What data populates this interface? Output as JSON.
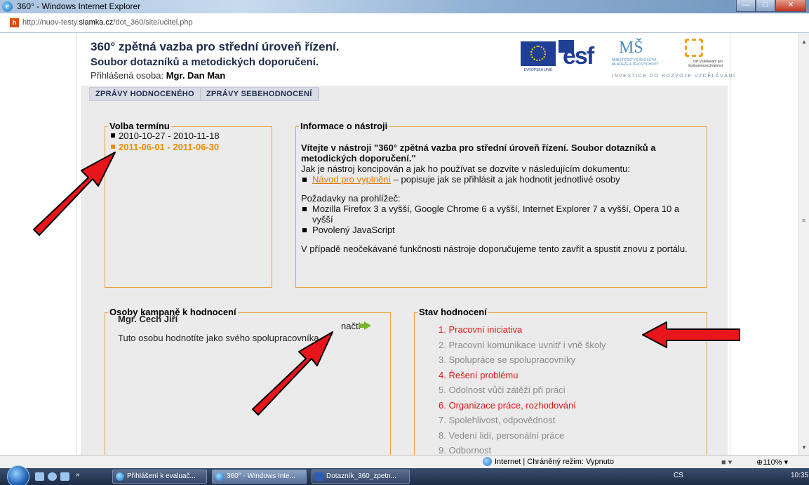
{
  "window": {
    "title": "360° - Windows Internet Explorer",
    "url_prefix": "http://nuov-testy.",
    "url_domain": "slamka.cz",
    "url_suffix": "/dot_360/site/ucitel.php"
  },
  "header": {
    "title": "360° zpětná vazba pro střední úroveň řízení.",
    "subtitle": "Soubor dotazníků a metodických doporučení.",
    "user_label": "Přihlášená osoba:",
    "user_name": "Mgr. Dan Man",
    "logo_tagline": "INVESTICE DO ROZVOJE VZDĚLÁVÁNÍ",
    "logo_eu_caption": "EVROPSKÁ UNIE",
    "logo_esf_text": "esf",
    "logo_msmt_caption": "MINISTERSTVO ŠKOLSTVÍ, MLÁDEŽE A TĚLOVÝCHOVY",
    "logo_op_caption": "OP Vzdělávání pro konkurenceschopnost"
  },
  "menu": [
    {
      "label": "ZPRÁVY HODNOCENÉHO"
    },
    {
      "label": "ZPRÁVY SEBEHODNOCENÍ"
    }
  ],
  "volba": {
    "legend": "Volba termínu",
    "terms": [
      {
        "label": "2010-10-27 - 2010-11-18"
      },
      {
        "label": "2011-06-01 - 2011-06-30"
      }
    ]
  },
  "info": {
    "legend": "Informace o nástroji",
    "welcome": "Vítejte v nástroji \"360° zpětná vazba pro střední úroveň řízení. Soubor dotazníků a metodických doporučení.\"",
    "intro": "Jak je nástroj koncipován a jak ho používat se dozvíte v následujícím dokumentu:",
    "doc_link": "Návod pro vyplnění",
    "doc_desc": " – popisuje jak se přihlásit a jak hodnotit jednotlivé osoby",
    "req_label": "Požadavky na prohlížeč:",
    "req_items": [
      "Mozilla Firefox 3 a vyšší, Google Chrome 6 a vyšší, Internet Explorer 7 a vyšší, Opera 10 a vyšší",
      "Povolený JavaScript"
    ],
    "note": "V případě neočekávané funkčnosti nástroje doporučujeme tento zavřít a spustit znovu z portálu."
  },
  "osoby": {
    "legend": "Osoby kampaně k hodnocení",
    "person_name": "Mgr. Čech Jiří",
    "load_label": "načti",
    "description": "Tuto osobu hodnotíte jako svého spolupracovníka"
  },
  "stav": {
    "legend": "Stav hodnocení",
    "items": [
      {
        "label": "1. Pracovní iniciativa",
        "state": "red"
      },
      {
        "label": "2. Pracovní komunikace uvnitř i vně školy",
        "state": "gray"
      },
      {
        "label": "3. Spolupráce se spolupracovníky",
        "state": "gray"
      },
      {
        "label": "4. Řešení problému",
        "state": "red"
      },
      {
        "label": "5. Odolnost vůči zátěži při práci",
        "state": "gray"
      },
      {
        "label": "6. Organizace práce, rozhodování",
        "state": "red"
      },
      {
        "label": "7. Spolehlivost, odpovědnost",
        "state": "gray"
      },
      {
        "label": "8. Vedení lidí, personální práce",
        "state": "gray"
      },
      {
        "label": "9. Odbornost",
        "state": "gray"
      }
    ]
  },
  "statusbar": {
    "zone": "Internet | Chráněný režim: Vypnuto",
    "zoom": "110%"
  },
  "taskbar": {
    "buttons": [
      {
        "label": "Přihlášení k evaluač..."
      },
      {
        "label": "360° - Windows Inte..."
      },
      {
        "label": "Dotazník_360_zpetn..."
      }
    ],
    "tray": "CS",
    "clock": "10:35"
  },
  "colors": {
    "accent_orange": "#f08a00",
    "arrow_red": "#e8161a",
    "box_border": "#e8a13a",
    "status_red": "#e0141a"
  }
}
